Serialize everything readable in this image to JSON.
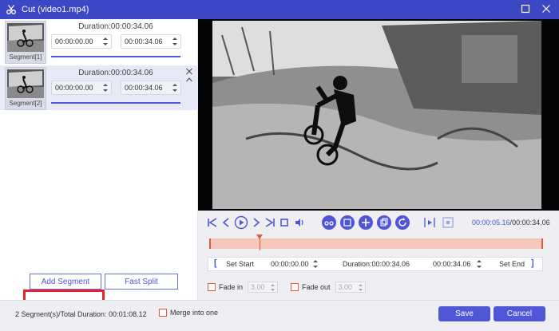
{
  "window": {
    "title": "Cut (video1.mp4)"
  },
  "segments": [
    {
      "label": "Segment[1]",
      "duration": "Duration:00:00:34.06",
      "start": "00:00:00.00",
      "end": "00:00:34.06"
    },
    {
      "label": "Segment[2]",
      "duration": "Duration:00:00:34.06",
      "start": "00:00:00.00",
      "end": "00:00:34.06"
    }
  ],
  "actions": {
    "add_segment": "Add Segment",
    "fast_split": "Fast Split"
  },
  "player": {
    "current_time": "00:00:05.16",
    "separator": "/",
    "total_time": "00:00:34.06",
    "playhead_fraction": 0.15
  },
  "setbar": {
    "set_start": "Set Start",
    "start_value": "00:00:00.00",
    "duration": "Duration:00:00:34.06",
    "end_value": "00:00:34.06",
    "set_end": "Set End"
  },
  "fade": {
    "fade_in_label": "Fade in",
    "fade_in_value": "3.00",
    "fade_out_label": "Fade out",
    "fade_out_value": "3.00"
  },
  "footer": {
    "summary": "2 Segment(s)/Total Duration: 00:01:08.12",
    "merge_label": "Merge into one",
    "save": "Save",
    "cancel": "Cancel"
  },
  "colors": {
    "accent": "#4f57d6",
    "titlebar": "#3b47c5",
    "track": "#f6c8bb",
    "marker": "#e25b3c",
    "highlight": "#e5232e"
  },
  "icons": [
    "scissors-icon",
    "maximize-icon",
    "close-icon",
    "jump-start-icon",
    "prev-frame-icon",
    "play-icon",
    "next-frame-icon",
    "jump-end-icon",
    "stop-icon",
    "volume-icon",
    "split-icon",
    "copy-icon",
    "add-icon",
    "duplicate-icon",
    "reset-icon",
    "preview-segment-icon",
    "fit-icon"
  ]
}
